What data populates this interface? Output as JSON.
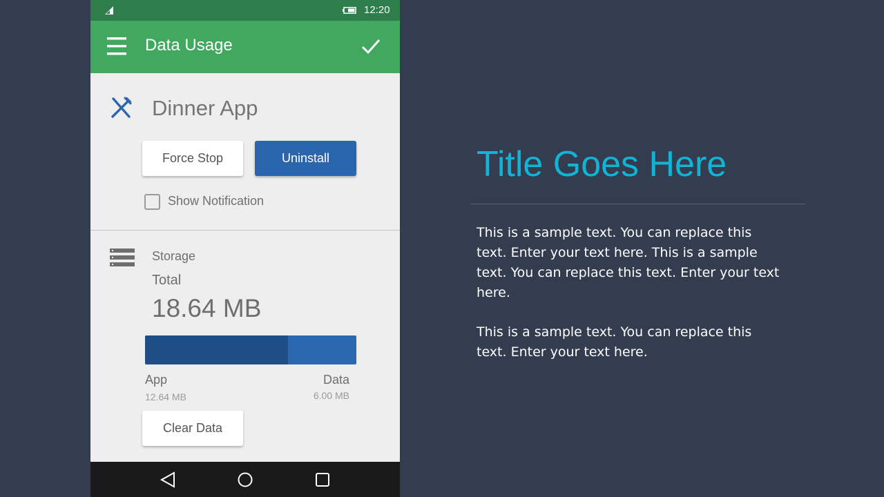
{
  "status_bar": {
    "time": "12:20"
  },
  "app_bar": {
    "title": "Data Usage"
  },
  "app_info": {
    "name": "Dinner App",
    "force_stop_label": "Force Stop",
    "uninstall_label": "Uninstall",
    "show_notification_label": "Show Notification",
    "show_notification_checked": false
  },
  "storage": {
    "heading": "Storage",
    "total_label": "Total",
    "total_value": "18.64 MB",
    "app_label": "App",
    "app_size": "12.64 MB",
    "data_label": "Data",
    "data_size": "6.00 MB",
    "app_fraction": 0.678,
    "clear_data_label": "Clear Data"
  },
  "slide": {
    "title": "Title Goes Here",
    "paragraphs": [
      "This is a sample text. You can replace this text. Enter your text here. This is a sample text. You can replace this text. Enter your text here.",
      "This is a sample text. You can replace this text. Enter your text here."
    ]
  },
  "colors": {
    "status_bar": "#2e7d4a",
    "app_bar": "#42a85f",
    "primary_blue": "#2b66ad",
    "bar_app": "#1f4e86",
    "bar_data": "#2b68b0",
    "slide_background": "#343d4f",
    "title_accent": "#12b4d6"
  },
  "icons": {
    "status": [
      "signal-icon",
      "battery-icon"
    ],
    "app_bar": [
      "menu-icon",
      "check-icon"
    ],
    "app": "utensils-icon",
    "storage": "storage-icon",
    "navigation": [
      "back-icon",
      "home-icon",
      "recent-apps-icon"
    ]
  }
}
